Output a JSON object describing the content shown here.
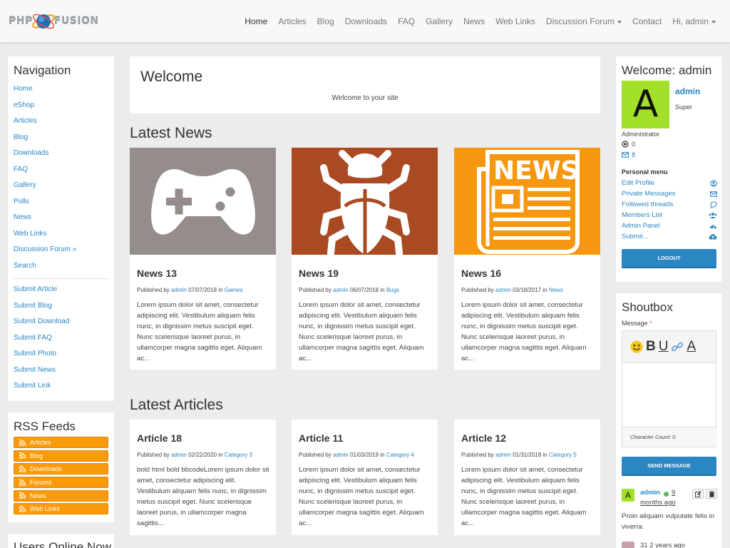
{
  "site": {
    "logo_left": "PHP",
    "logo_right": "FUSION"
  },
  "topnav": {
    "items": [
      "Home",
      "Articles",
      "Blog",
      "Downloads",
      "FAQ",
      "Gallery",
      "News",
      "Web Links"
    ],
    "forum": "Discussion Forum",
    "contact": "Contact",
    "user": "Hi, admin"
  },
  "navigation": {
    "title": "Navigation",
    "items": [
      "Home",
      "eShop",
      "Articles",
      "Blog",
      "Downloads",
      "FAQ",
      "Gallery",
      "Polls",
      "News",
      "Web Links",
      "Discussion Forum »",
      "Search"
    ],
    "submit_items": [
      "Submit Article",
      "Submit Blog",
      "Submit Download",
      "Submit FAQ",
      "Submit Photo",
      "Submit News",
      "Submit Link"
    ]
  },
  "rss": {
    "title": "RSS Feeds",
    "items": [
      "Articles",
      "Blog",
      "Downloads",
      "Forums",
      "News",
      "Web Links"
    ]
  },
  "users_online": {
    "title": "Users Online Now"
  },
  "welcome": {
    "title": "Welcome",
    "text": "Welcome to your site"
  },
  "latest_news": {
    "title": "Latest News",
    "items": [
      {
        "title": "News 13",
        "published": "Published by",
        "author": "admin",
        "date": "07/07/2018 in",
        "category": "Games",
        "body": "Lorem ipsum dolor sit amet, consectetur adipiscing elit. Vestibulum aliquam felis nunc, in dignissim metus suscipit eget. Nunc scelerisque laoreet purus, in ullamcorper magna sagittis eget. Aliquam ac...",
        "thumb_color": "#958d8b",
        "thumb_icon": "gamepad-icon"
      },
      {
        "title": "News 19",
        "published": "Published by",
        "author": "admin",
        "date": "06/07/2018 in",
        "category": "Bugs",
        "body": "Lorem ipsum dolor sit amet, consectetur adipiscing elit. Vestibulum aliquam felis nunc, in dignissim metus suscipit eget. Nunc scelerisque laoreet purus, in ullamcorper magna sagittis eget. Aliquam ac...",
        "thumb_color": "#a94a22",
        "thumb_icon": "bug-icon"
      },
      {
        "title": "News 16",
        "published": "Published by",
        "author": "admin",
        "date": "03/18/2017 in",
        "category": "News",
        "body": "Lorem ipsum dolor sit amet, consectetur adipiscing elit. Vestibulum aliquam felis nunc, in dignissim metus suscipit eget. Nunc scelerisque laoreet purus, in ullamcorper magna sagittis eget. Aliquam ac...",
        "thumb_color": "#f7960f",
        "thumb_icon": "newspaper-icon"
      }
    ]
  },
  "latest_articles": {
    "title": "Latest Articles",
    "items": [
      {
        "title": "Article 18",
        "published": "Published by",
        "author": "admin",
        "date": "02/22/2020 in",
        "category": "Category 3",
        "body": "bold html bold bbcodeLorem ipsum dolor sit amet, consectetur adipiscing elit. Vestibulum aliquam felis nunc, in dignissim metus suscipit eget. Nunc scelerisque laoreet purus, in ullamcorper magna sagittis..."
      },
      {
        "title": "Article 11",
        "published": "Published by",
        "author": "admin",
        "date": "01/03/2019 in",
        "category": "Category 4",
        "body": "Lorem ipsum dolor sit amet, consectetur adipiscing elit. Vestibulum aliquam felis nunc, in dignissim metus suscipit eget. Nunc scelerisque laoreet purus, in ullamcorper magna sagittis eget. Aliquam ac..."
      },
      {
        "title": "Article 12",
        "published": "Published by",
        "author": "admin",
        "date": "01/31/2018 in",
        "category": "Category 5",
        "body": "Lorem ipsum dolor sit amet, consectetur adipiscing elit. Vestibulum aliquam felis nunc, in dignissim metus suscipit eget. Nunc scelerisque laoreet purus, in ullamcorper magna sagittis eget. Aliquam ac..."
      }
    ]
  },
  "user_panel": {
    "title": "Welcome: admin",
    "avatar_letter": "A",
    "name": "admin",
    "rank_line1": "Super",
    "rank_line2": "Administrator",
    "stat1": "0",
    "stat2": "8",
    "menu_title": "Personal menu",
    "menu": [
      "Edit Profile",
      "Private Messages",
      "Followed threads",
      "Members List",
      "Admin Panel",
      "Submit..."
    ],
    "logout": "LOGOUT"
  },
  "shoutbox": {
    "title": "Shoutbox",
    "message_label": "Message",
    "required_mark": "*",
    "char_count": "Character Count: 0",
    "send": "SEND MESSAGE",
    "entry": {
      "avatar_letter": "A",
      "user": "admin",
      "time_a": "9",
      "time_b": "months ago",
      "text": "Proin aliquam vulputate felis in viverra."
    },
    "entry2": {
      "text": "31 2 years ago"
    }
  },
  "colors": {
    "accent": "#2a87c4",
    "rss_orange": "#fb9b0b",
    "avatar_green": "#a3e02a"
  }
}
